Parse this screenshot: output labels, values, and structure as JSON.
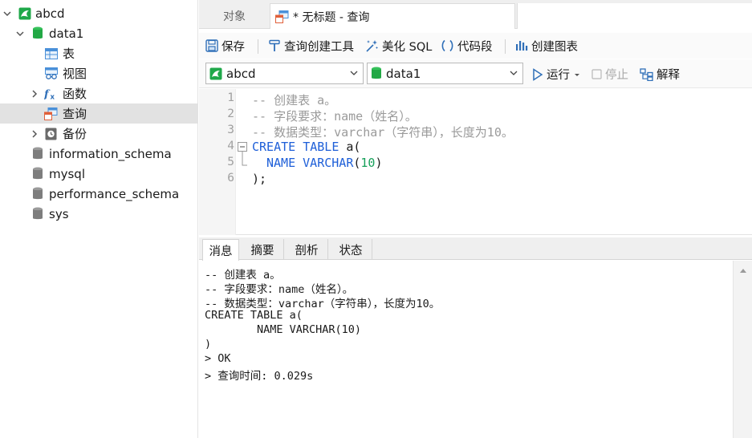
{
  "sidebar": {
    "connection": {
      "label": "abcd"
    },
    "database": {
      "label": "data1"
    },
    "items": [
      {
        "label": "表"
      },
      {
        "label": "视图"
      },
      {
        "label": "函数"
      },
      {
        "label": "查询"
      },
      {
        "label": "备份"
      }
    ],
    "other_databases": [
      {
        "label": "information_schema"
      },
      {
        "label": "mysql"
      },
      {
        "label": "performance_schema"
      },
      {
        "label": "sys"
      }
    ]
  },
  "tabs": {
    "objects": "对象",
    "query": "* 无标题 - 查询"
  },
  "toolbar": {
    "save": "保存",
    "query_builder": "查询创建工具",
    "beautify": "美化 SQL",
    "snippet": "代码段",
    "create_chart": "创建图表"
  },
  "selectors": {
    "connection": "abcd",
    "database": "data1",
    "run": "运行",
    "stop": "停止",
    "explain": "解释"
  },
  "editor": {
    "line_numbers": [
      "1",
      "2",
      "3",
      "4",
      "5",
      "6"
    ],
    "lines": [
      {
        "text": "-- 创建表 a。"
      },
      {
        "text": "-- 字段要求：name（姓名）。"
      },
      {
        "text": "-- 数据类型：varchar（字符串），长度为10。"
      },
      {
        "kw1": "CREATE TABLE",
        "rest": " a("
      },
      {
        "kw1": "NAME VARCHAR",
        "p1": "(",
        "num": "10",
        "p2": ")"
      },
      {
        "text": ");"
      }
    ]
  },
  "result": {
    "tabs": [
      "消息",
      "摘要",
      "剖析",
      "状态"
    ],
    "messages": [
      "-- 创建表 a。",
      "-- 字段要求：name（姓名）。",
      "-- 数据类型：varchar（字符串），长度为10。",
      "CREATE TABLE a(",
      "        NAME VARCHAR(10)",
      ")",
      "> OK",
      "> 查询时间: 0.029s"
    ]
  },
  "colors": {
    "connection_green": "#1fa84a",
    "database_green": "#22a845",
    "keyword_blue": "#1e5fd8",
    "number_green": "#17a05a",
    "comment_gray": "#9a9a9a"
  }
}
